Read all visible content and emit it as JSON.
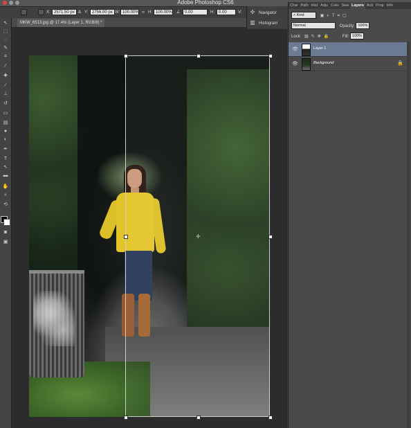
{
  "app": {
    "title": "Adobe Photoshop CS6"
  },
  "options_bar": {
    "x_label": "X:",
    "x_value": "2571.50 px",
    "delta_label": "Δ",
    "y_label": "Y:",
    "y_value": "2756.00 px",
    "w_label": "W:",
    "w_value": "100.00%",
    "link_label": "∞",
    "h_label": "H:",
    "h_value": "100.00%",
    "angle_label": "∠",
    "angle_value": "0.00",
    "hskew_label": "H:",
    "hskew_value": "0.00",
    "vskew_label": "V:"
  },
  "document": {
    "tab_title": "MKW_6513.jpg @ 17.4% (Layer 1, RGB/8) *"
  },
  "dock": {
    "navigator": "Navigator",
    "histogram": "Histogram"
  },
  "panel": {
    "tabs": [
      "Chai",
      "Path",
      "Hist",
      "Adju",
      "Colo",
      "Swa",
      "Layers",
      "Acti",
      "Prop",
      "Info"
    ],
    "active_tab": "Layers",
    "kind_label": "Kind",
    "blend_mode": "Normal",
    "opacity_label": "Opacity:",
    "opacity_value": "100%",
    "lock_label": "Lock:",
    "fill_label": "Fill:",
    "fill_value": "100%",
    "layers": [
      {
        "name": "Layer 1",
        "selected": true
      },
      {
        "name": "Background",
        "selected": false,
        "locked": true
      }
    ]
  },
  "colors": {
    "selected_layer": "#6b7b93",
    "panel_bg": "#4a4a4a",
    "canvas_bg": "#2c2c2c"
  }
}
